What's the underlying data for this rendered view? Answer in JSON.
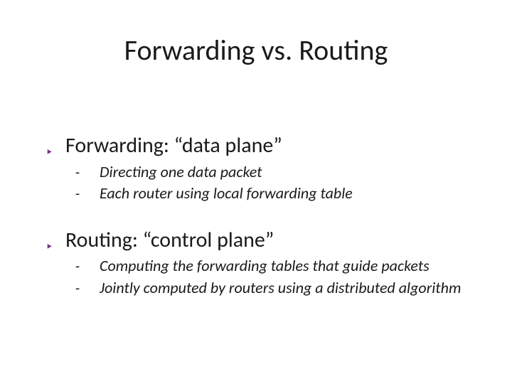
{
  "title": "Forwarding vs. Routing",
  "bullets": [
    {
      "text": "Forwarding: “data plane”",
      "subs": [
        "Directing one data packet",
        "Each router using local forwarding table"
      ]
    },
    {
      "text": "Routing: “control plane”",
      "subs": [
        "Computing the forwarding tables that guide packets",
        "Jointly computed by routers using a distributed algorithm"
      ]
    }
  ]
}
